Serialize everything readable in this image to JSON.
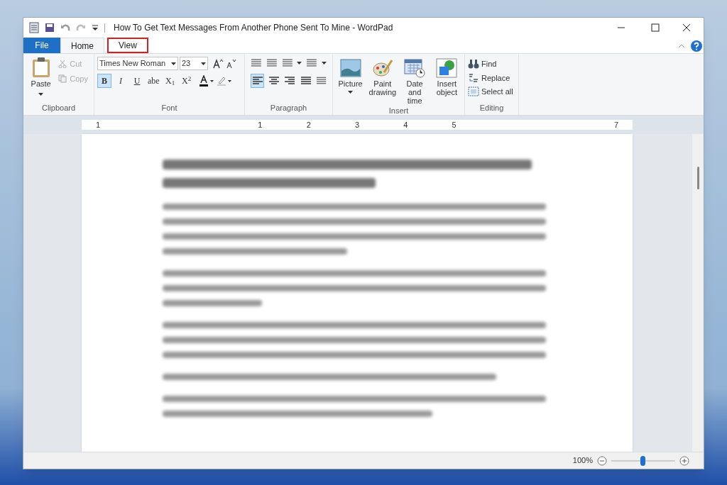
{
  "window": {
    "title": "How To Get Text Messages From Another Phone Sent To Mine - WordPad"
  },
  "tabs": [
    {
      "label": "File",
      "kind": "file",
      "selected": false,
      "highlighted": false
    },
    {
      "label": "Home",
      "kind": "tab",
      "selected": true,
      "highlighted": false
    },
    {
      "label": "View",
      "kind": "tab",
      "selected": false,
      "highlighted": true
    }
  ],
  "clipboard": {
    "paste": "Paste",
    "cut": "Cut",
    "copy": "Copy",
    "group": "Clipboard"
  },
  "font": {
    "family": "Times New Roman",
    "size": "23",
    "group": "Font",
    "buttons": [
      {
        "label": "B",
        "selected": true
      },
      {
        "label": "I",
        "selected": false
      },
      {
        "label": "U",
        "selected": false
      },
      {
        "label": "abe",
        "selected": false
      },
      {
        "label": "X$_{1}$",
        "selected": false
      },
      {
        "label": "X$^{2}$",
        "selected": false
      }
    ]
  },
  "paragraph": {
    "group": "Paragraph",
    "align": [
      {
        "selected": true
      },
      {
        "selected": false
      },
      {
        "selected": false
      },
      {
        "selected": false
      }
    ]
  },
  "insert": {
    "group": "Insert",
    "items": [
      {
        "label": "Picture",
        "kind": "picture",
        "dropdown": true
      },
      {
        "label": "Paint drawing",
        "kind": "paint",
        "dropdown": false
      },
      {
        "label": "Date and time",
        "kind": "calendar",
        "dropdown": false
      },
      {
        "label": "Insert object",
        "kind": "object",
        "dropdown": false
      }
    ]
  },
  "editing": {
    "group": "Editing",
    "items": [
      {
        "label": "Find",
        "kind": "find"
      },
      {
        "label": "Replace",
        "kind": "replace"
      },
      {
        "label": "Select all",
        "kind": "select"
      }
    ]
  },
  "ruler": {
    "labels": [
      "1",
      "1",
      "2",
      "3",
      "4",
      "5",
      "7"
    ]
  },
  "status_bar": {
    "zoom": "100%",
    "level": 0.5
  }
}
